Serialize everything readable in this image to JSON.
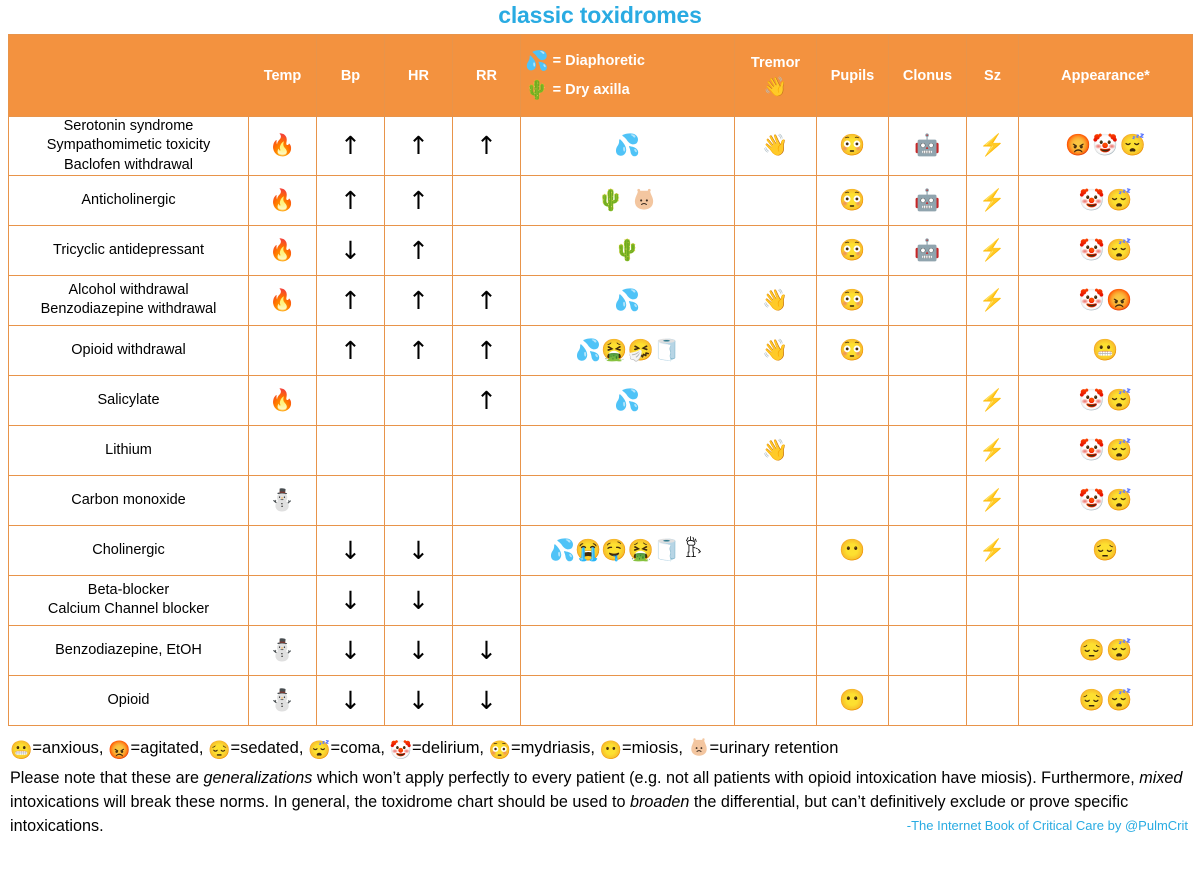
{
  "title": "classic toxidromes",
  "header": {
    "name_col": "",
    "columns": [
      "Temp",
      "Bp",
      "HR",
      "RR"
    ],
    "diaphoretic_icon": "💦",
    "diaphoretic_label": "= Diaphoretic",
    "dry_axilla_icon": "🌵",
    "dry_axilla_label": "= Dry axilla",
    "tremor": "Tremor",
    "tremor_icon": "👋",
    "pupils": "Pupils",
    "clonus": "Clonus",
    "sz": "Sz",
    "appearance": "Appearance*"
  },
  "icons": {
    "fire": "🔥",
    "snowman": "⛄",
    "up": "↑",
    "down": "↓",
    "sweat": "💦",
    "cactus": "🌵",
    "tremor": "👋",
    "mydriasis": "😳",
    "miosis": "😶",
    "robot": "🤖",
    "bolt": "⚡",
    "agitated": "😡",
    "delirium": "🤡",
    "coma": "😴",
    "sedated": "😔",
    "anxious": "😬",
    "vomit": "🤮",
    "sneeze": "🤧",
    "toilet_paper": "🧻",
    "crying": "😭",
    "drooling": "🤤"
  },
  "rows": [
    {
      "name": "Serotonin syndrome\nSympathomimetic toxicity\nBaclofen withdrawal",
      "temp": "🔥",
      "bp": "↑",
      "hr": "↑",
      "rr": "↑",
      "skin": [
        "💦"
      ],
      "tremor": "👋",
      "pupils": "😳",
      "clonus": "🤖",
      "sz": "⚡",
      "appearance": [
        "😡",
        "🤡",
        "😴"
      ]
    },
    {
      "name": "Anticholinergic",
      "temp": "🔥",
      "bp": "↑",
      "hr": "↑",
      "rr": "",
      "skin": [
        "🌵",
        "bladder"
      ],
      "tremor": "",
      "pupils": "😳",
      "clonus": "🤖",
      "sz": "⚡",
      "appearance": [
        "🤡",
        "😴"
      ]
    },
    {
      "name": "Tricyclic antidepressant",
      "temp": "🔥",
      "bp": "↓",
      "hr": "↑",
      "rr": "",
      "skin": [
        "🌵"
      ],
      "tremor": "",
      "pupils": "😳",
      "clonus": "🤖",
      "sz": "⚡",
      "appearance": [
        "🤡",
        "😴"
      ]
    },
    {
      "name": "Alcohol withdrawal\nBenzodiazepine withdrawal",
      "temp": "🔥",
      "bp": "↑",
      "hr": "↑",
      "rr": "↑",
      "skin": [
        "💦"
      ],
      "tremor": "👋",
      "pupils": "😳",
      "clonus": "",
      "sz": "⚡",
      "appearance": [
        "🤡",
        "😡"
      ]
    },
    {
      "name": "Opioid withdrawal",
      "temp": "",
      "bp": "↑",
      "hr": "↑",
      "rr": "↑",
      "skin": [
        "💦",
        "🤮",
        "🤧",
        "🧻"
      ],
      "tremor": "👋",
      "pupils": "😳",
      "clonus": "",
      "sz": "",
      "appearance": [
        "😬"
      ]
    },
    {
      "name": "Salicylate",
      "temp": "🔥",
      "bp": "",
      "hr": "",
      "rr": "↑",
      "skin": [
        "💦"
      ],
      "tremor": "",
      "pupils": "",
      "clonus": "",
      "sz": "⚡",
      "appearance": [
        "🤡",
        "😴"
      ]
    },
    {
      "name": "Lithium",
      "temp": "",
      "bp": "",
      "hr": "",
      "rr": "",
      "skin": [],
      "tremor": "👋",
      "pupils": "",
      "clonus": "",
      "sz": "⚡",
      "appearance": [
        "🤡",
        "😴"
      ]
    },
    {
      "name": "Carbon monoxide",
      "temp": "⛄",
      "bp": "",
      "hr": "",
      "rr": "",
      "skin": [],
      "tremor": "",
      "pupils": "",
      "clonus": "",
      "sz": "⚡",
      "appearance": [
        "🤡",
        "😴"
      ]
    },
    {
      "name": "Cholinergic",
      "temp": "",
      "bp": "↓",
      "hr": "↓",
      "rr": "",
      "skin": [
        "💦",
        "😭",
        "🤤",
        "🤮",
        "🧻",
        "pee"
      ],
      "tremor": "",
      "pupils": "😶",
      "clonus": "",
      "sz": "⚡",
      "appearance": [
        "😔"
      ]
    },
    {
      "name": "Beta-blocker\nCalcium Channel blocker",
      "temp": "",
      "bp": "↓",
      "hr": "↓",
      "rr": "",
      "skin": [],
      "tremor": "",
      "pupils": "",
      "clonus": "",
      "sz": "",
      "appearance": []
    },
    {
      "name": "Benzodiazepine, EtOH",
      "temp": "⛄",
      "bp": "↓",
      "hr": "↓",
      "rr": "↓",
      "skin": [],
      "tremor": "",
      "pupils": "",
      "clonus": "",
      "sz": "",
      "appearance": [
        "😔",
        "😴"
      ]
    },
    {
      "name": "Opioid",
      "temp": "⛄",
      "bp": "↓",
      "hr": "↓",
      "rr": "↓",
      "skin": [],
      "tremor": "",
      "pupils": "😶",
      "clonus": "",
      "sz": "",
      "appearance": [
        "😔",
        "😴"
      ]
    }
  ],
  "legend": [
    {
      "icon": "😬",
      "text": "=anxious,"
    },
    {
      "icon": "😡",
      "text": "=agitated,"
    },
    {
      "icon": "😔",
      "text": "=sedated,"
    },
    {
      "icon": "😴",
      "text": "=coma,"
    },
    {
      "icon": "🤡",
      "text": "=delirium,"
    },
    {
      "icon": "😳",
      "text": "=mydriasis,"
    },
    {
      "icon": "😶",
      "text": "=miosis,"
    },
    {
      "icon": "bladder",
      "text": "=urinary retention"
    }
  ],
  "notes": {
    "p1_a": "Please note that these are ",
    "p1_i": "generalizations",
    "p1_b": " which won’t apply perfectly to every patient (e.g. not all patients with opioid intoxication have miosis).  Furthermore, ",
    "p1_i2": "mixed",
    "p1_c": " intoxications will break these norms.  In general, the toxidrome chart should be used to ",
    "p1_i3": "broaden",
    "p1_d": " the differential, but can’t definitively exclude or prove specific intoxications."
  },
  "credit": "-The Internet Book of Critical Care by @PulmCrit",
  "colors": {
    "header_bg": "#F3923F",
    "border": "#E8944A",
    "title": "#29ABE2",
    "credit": "#29ABE2"
  }
}
